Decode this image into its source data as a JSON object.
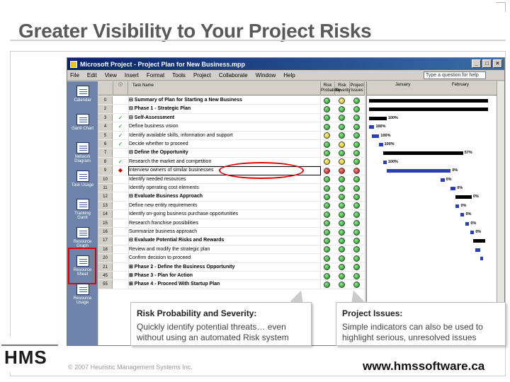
{
  "slide_title": "Greater Visibility to Your Project Risks",
  "window": {
    "title": "Microsoft Project - Project Plan for New Business.mpp",
    "buttons": [
      "_",
      "□",
      "×"
    ]
  },
  "menu": {
    "items": [
      "File",
      "Edit",
      "View",
      "Insert",
      "Format",
      "Tools",
      "Project",
      "Collaborate",
      "Window",
      "Help"
    ],
    "help_box": "Type a question for help"
  },
  "view_bar": {
    "items": [
      "Calendar",
      "Gantt Chart",
      "Network Diagram",
      "Task Usage",
      "Tracking Gantt",
      "Resource Graph",
      "Resource Sheet",
      "Resource Usage"
    ]
  },
  "sheet": {
    "columns": [
      "Task Name",
      "Risk Probability",
      "Risk Severity",
      "Project Issues"
    ],
    "rows": [
      {
        "id": "0",
        "ind": "",
        "name": "⊟ Summary of Plan for Starting a New Business",
        "bold": true,
        "risk": "g",
        "sev": "y",
        "iss": "g"
      },
      {
        "id": "2",
        "ind": "",
        "name": "  ⊟ Phase 1 - Strategic Plan",
        "bold": true,
        "risk": "g",
        "sev": "g",
        "iss": "g"
      },
      {
        "id": "3",
        "ind": "✓",
        "name": "     ⊟ Self-Assessment",
        "bold": true,
        "risk": "g",
        "sev": "g",
        "iss": "g"
      },
      {
        "id": "4",
        "ind": "✓",
        "name": "          Define business vision",
        "bold": false,
        "risk": "g",
        "sev": "g",
        "iss": "g"
      },
      {
        "id": "5",
        "ind": "✓",
        "name": "          Identify available skills, information and support",
        "bold": false,
        "risk": "y",
        "sev": "g",
        "iss": "g"
      },
      {
        "id": "6",
        "ind": "✓",
        "name": "          Decide whether to proceed",
        "bold": false,
        "risk": "g",
        "sev": "y",
        "iss": "g"
      },
      {
        "id": "7",
        "ind": "",
        "name": "     ⊟ Define the Opportunity",
        "bold": true,
        "risk": "g",
        "sev": "g",
        "iss": "g"
      },
      {
        "id": "8",
        "ind": "✓",
        "name": "          Research the market and competition",
        "bold": false,
        "risk": "y",
        "sev": "y",
        "iss": "g"
      },
      {
        "id": "9",
        "ind": "◆",
        "name": "          Interview owners of similar businesses",
        "bold": false,
        "risk": "r",
        "sev": "r",
        "iss": "r"
      },
      {
        "id": "10",
        "ind": "",
        "name": "          Identify needed resources",
        "bold": false,
        "risk": "g",
        "sev": "g",
        "iss": "g"
      },
      {
        "id": "11",
        "ind": "",
        "name": "          Identify operating cost elements",
        "bold": false,
        "risk": "g",
        "sev": "g",
        "iss": "g"
      },
      {
        "id": "12",
        "ind": "",
        "name": "     ⊟ Evaluate Business Approach",
        "bold": true,
        "risk": "g",
        "sev": "g",
        "iss": "g"
      },
      {
        "id": "13",
        "ind": "",
        "name": "          Define new entity requirements",
        "bold": false,
        "risk": "g",
        "sev": "g",
        "iss": "g"
      },
      {
        "id": "14",
        "ind": "",
        "name": "          Identify on-going business purchase opportunities",
        "bold": false,
        "risk": "g",
        "sev": "g",
        "iss": "g"
      },
      {
        "id": "15",
        "ind": "",
        "name": "          Research franchise possibilities",
        "bold": false,
        "risk": "g",
        "sev": "g",
        "iss": "g"
      },
      {
        "id": "16",
        "ind": "",
        "name": "          Summarize business approach",
        "bold": false,
        "risk": "g",
        "sev": "g",
        "iss": "g"
      },
      {
        "id": "17",
        "ind": "",
        "name": "     ⊟ Evaluate Potential Risks and Rewards",
        "bold": true,
        "risk": "g",
        "sev": "g",
        "iss": "g"
      },
      {
        "id": "18",
        "ind": "",
        "name": "          Review and modify the strategic plan",
        "bold": false,
        "risk": "g",
        "sev": "g",
        "iss": "g"
      },
      {
        "id": "20",
        "ind": "",
        "name": "          Confirm decision to proceed",
        "bold": false,
        "risk": "g",
        "sev": "g",
        "iss": "g"
      },
      {
        "id": "21",
        "ind": "",
        "name": "  ⊞ Phase 2 - Define the Business Opportunity",
        "bold": true,
        "risk": "g",
        "sev": "g",
        "iss": "g"
      },
      {
        "id": "45",
        "ind": "",
        "name": "  ⊞ Phase 3 - Plan for Action",
        "bold": true,
        "risk": "g",
        "sev": "g",
        "iss": "g"
      },
      {
        "id": "55",
        "ind": "",
        "name": "  ⊞ Phase 4 - Proceed With Startup Plan",
        "bold": true,
        "risk": "g",
        "sev": "g",
        "iss": "g"
      }
    ]
  },
  "gantt": {
    "months": [
      "January",
      "February"
    ],
    "bars": [
      {
        "row": 0,
        "start": 0.02,
        "end": 0.98,
        "pct": ""
      },
      {
        "row": 1,
        "start": 0.02,
        "end": 0.98,
        "pct": ""
      },
      {
        "row": 2,
        "start": 0.02,
        "end": 0.16,
        "pct": "100%"
      },
      {
        "row": 3,
        "start": 0.02,
        "end": 0.06,
        "pct": "100%"
      },
      {
        "row": 4,
        "start": 0.04,
        "end": 0.1,
        "pct": "100%"
      },
      {
        "row": 5,
        "start": 0.1,
        "end": 0.13,
        "pct": "100%"
      },
      {
        "row": 6,
        "start": 0.13,
        "end": 0.78,
        "pct": "57%"
      },
      {
        "row": 7,
        "start": 0.13,
        "end": 0.16,
        "pct": "100%"
      },
      {
        "row": 8,
        "start": 0.16,
        "end": 0.68,
        "pct": "0%"
      },
      {
        "row": 9,
        "start": 0.6,
        "end": 0.63,
        "pct": "0%"
      },
      {
        "row": 10,
        "start": 0.68,
        "end": 0.72,
        "pct": "0%"
      },
      {
        "row": 11,
        "start": 0.72,
        "end": 0.85,
        "pct": "0%"
      },
      {
        "row": 12,
        "start": 0.72,
        "end": 0.75,
        "pct": "0%"
      },
      {
        "row": 13,
        "start": 0.76,
        "end": 0.79,
        "pct": "0%"
      },
      {
        "row": 14,
        "start": 0.8,
        "end": 0.83,
        "pct": "0%"
      },
      {
        "row": 15,
        "start": 0.84,
        "end": 0.87,
        "pct": "0%"
      },
      {
        "row": 16,
        "start": 0.86,
        "end": 0.96,
        "pct": ""
      },
      {
        "row": 17,
        "start": 0.88,
        "end": 0.92,
        "pct": ""
      },
      {
        "row": 18,
        "start": 0.92,
        "end": 0.94,
        "pct": ""
      }
    ]
  },
  "callouts": [
    {
      "title": "Risk Probability and Severity:",
      "text": "Quickly identify potential threats… even without using an automated Risk system"
    },
    {
      "title": "Project Issues:",
      "text": "Simple indicators can also be used to highlight serious, unresolved issues"
    }
  ],
  "footer": {
    "logo": "HMS",
    "copyright": "© 2007 Heuristic Management Systems Inc.",
    "url": "www.hmssoftware.ca"
  }
}
